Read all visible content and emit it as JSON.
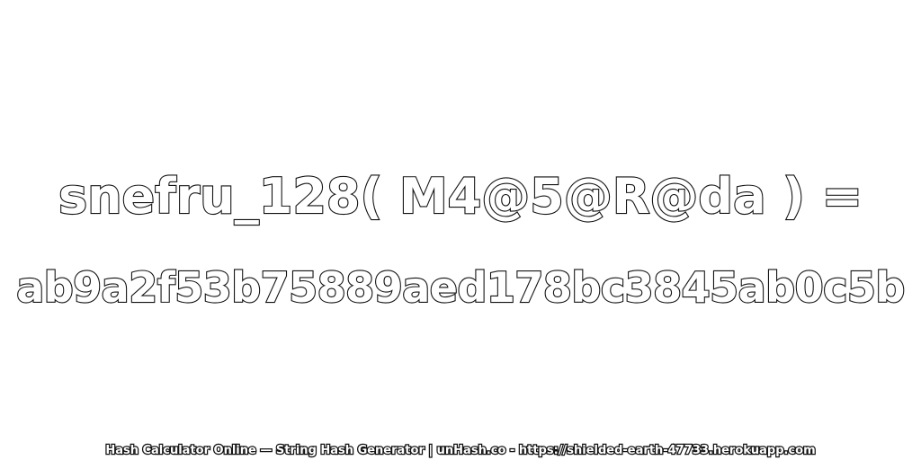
{
  "expression": "snefru_128( M4@5@R@da ) =",
  "hash": "ab9a2f53b75889aed178bc3845ab0c5b",
  "footer": "Hash Calculator Online — String Hash Generator | unHash.co - https://shielded-earth-47733.herokuapp.com",
  "colors": {
    "background": "#ffffff",
    "text_fill": "#ffffff",
    "text_outline": "#111111"
  }
}
